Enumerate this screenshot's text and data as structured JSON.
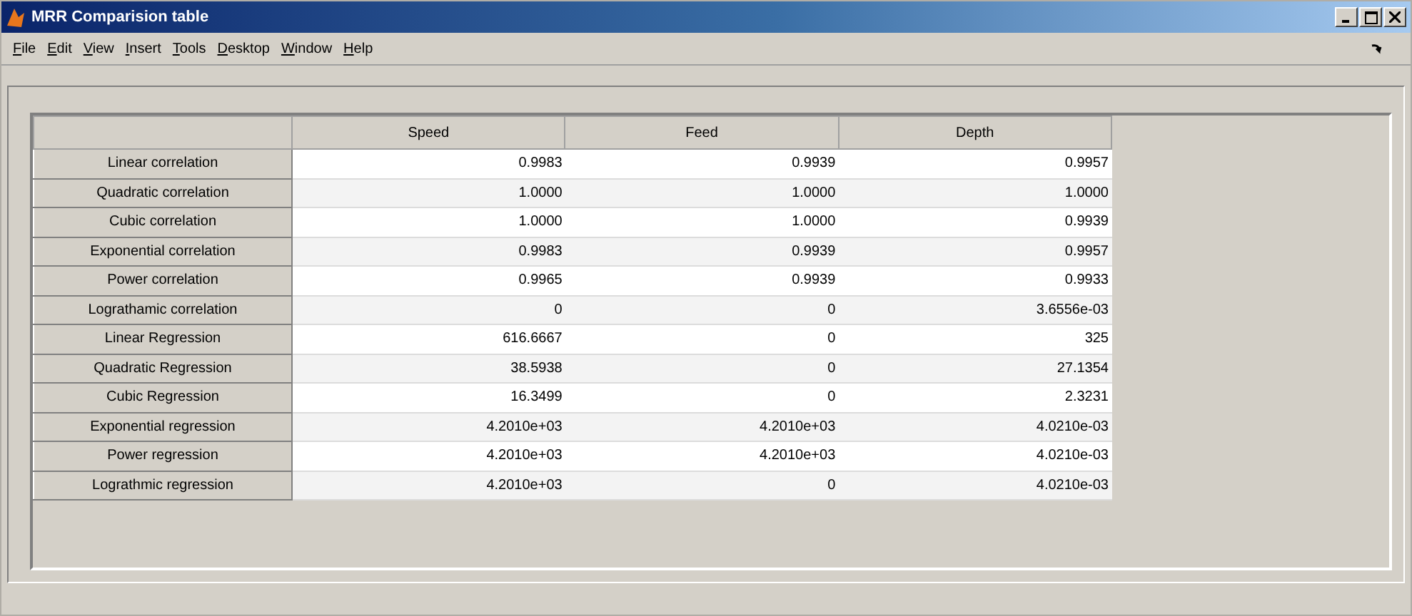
{
  "window": {
    "title": "MRR Comparision table"
  },
  "menu": [
    "File",
    "Edit",
    "View",
    "Insert",
    "Tools",
    "Desktop",
    "Window",
    "Help"
  ],
  "table": {
    "columns": [
      "Speed",
      "Feed",
      "Depth"
    ],
    "rows": [
      {
        "label": "Linear correlation",
        "cells": [
          "0.9983",
          "0.9939",
          "0.9957"
        ]
      },
      {
        "label": "Quadratic correlation",
        "cells": [
          "1.0000",
          "1.0000",
          "1.0000"
        ]
      },
      {
        "label": "Cubic correlation",
        "cells": [
          "1.0000",
          "1.0000",
          "0.9939"
        ]
      },
      {
        "label": "Exponential correlation",
        "cells": [
          "0.9983",
          "0.9939",
          "0.9957"
        ]
      },
      {
        "label": "Power correlation",
        "cells": [
          "0.9965",
          "0.9939",
          "0.9933"
        ]
      },
      {
        "label": "Lograthamic correlation",
        "cells": [
          "0",
          "0",
          "3.6556e-03"
        ]
      },
      {
        "label": "Linear Regression",
        "cells": [
          "616.6667",
          "0",
          "325"
        ]
      },
      {
        "label": "Quadratic Regression",
        "cells": [
          "38.5938",
          "0",
          "27.1354"
        ]
      },
      {
        "label": "Cubic Regression",
        "cells": [
          "16.3499",
          "0",
          "2.3231"
        ]
      },
      {
        "label": "Exponential regression",
        "cells": [
          "4.2010e+03",
          "4.2010e+03",
          "4.0210e-03"
        ]
      },
      {
        "label": "Power regression",
        "cells": [
          "4.2010e+03",
          "4.2010e+03",
          "4.0210e-03"
        ]
      },
      {
        "label": "Lograthmic regression",
        "cells": [
          "4.2010e+03",
          "0",
          "4.0210e-03"
        ]
      }
    ]
  }
}
